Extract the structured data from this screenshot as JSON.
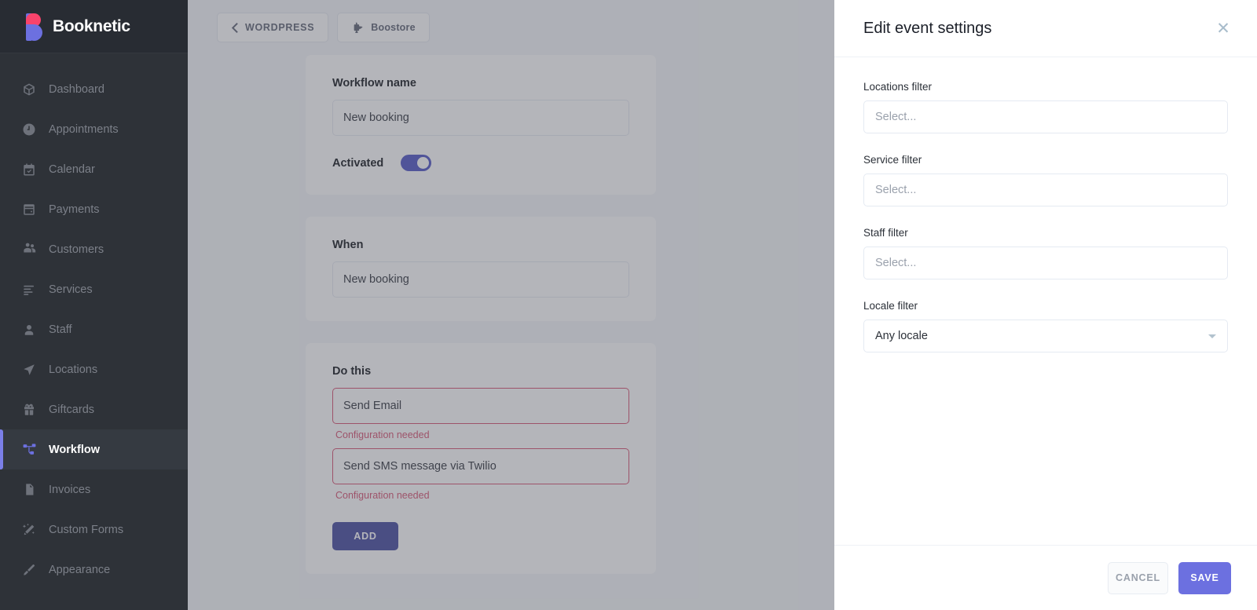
{
  "brand": {
    "name": "Booknetic",
    "logo_icon": "booknetic-b-logo",
    "accent_color": "#6c70e0",
    "logo_pink": "#f8436b"
  },
  "sidebar": {
    "items": [
      {
        "label": "Dashboard",
        "icon": "box-icon",
        "active": false
      },
      {
        "label": "Appointments",
        "icon": "clock-icon",
        "active": false
      },
      {
        "label": "Calendar",
        "icon": "calendar-icon",
        "active": false
      },
      {
        "label": "Payments",
        "icon": "wallet-icon",
        "active": false
      },
      {
        "label": "Customers",
        "icon": "users-icon",
        "active": false
      },
      {
        "label": "Services",
        "icon": "list-icon",
        "active": false
      },
      {
        "label": "Staff",
        "icon": "person-icon",
        "active": false
      },
      {
        "label": "Locations",
        "icon": "navigation-icon",
        "active": false
      },
      {
        "label": "Giftcards",
        "icon": "gift-icon",
        "active": false
      },
      {
        "label": "Workflow",
        "icon": "workflow-icon",
        "active": true
      },
      {
        "label": "Invoices",
        "icon": "document-icon",
        "active": false
      },
      {
        "label": "Custom Forms",
        "icon": "magic-wand-icon",
        "active": false
      },
      {
        "label": "Appearance",
        "icon": "paintbrush-icon",
        "active": false
      }
    ]
  },
  "topbar": {
    "back_label": "WORDPRESS",
    "back_icon": "chevron-left-icon",
    "boostore_label": "Boostore",
    "boostore_icon": "puzzle-piece-icon"
  },
  "workflow": {
    "name_card": {
      "label": "Workflow name",
      "value": "New booking",
      "activated_label": "Activated",
      "activated": true
    },
    "when_card": {
      "label": "When",
      "value": "New booking"
    },
    "do_card": {
      "label": "Do this",
      "actions": [
        {
          "value": "Send Email",
          "error": "Configuration needed"
        },
        {
          "value": "Send SMS message via Twilio",
          "error": "Configuration needed"
        }
      ],
      "add_label": "ADD"
    }
  },
  "panel": {
    "title": "Edit event settings",
    "close_icon": "close-icon",
    "fields": [
      {
        "label": "Locations filter",
        "placeholder": "Select...",
        "value": "",
        "has_caret": false
      },
      {
        "label": "Service filter",
        "placeholder": "Select...",
        "value": "",
        "has_caret": false
      },
      {
        "label": "Staff filter",
        "placeholder": "Select...",
        "value": "",
        "has_caret": false
      },
      {
        "label": "Locale filter",
        "placeholder": "",
        "value": "Any locale",
        "has_caret": true
      }
    ],
    "footer": {
      "cancel_label": "CANCEL",
      "save_label": "SAVE"
    }
  }
}
